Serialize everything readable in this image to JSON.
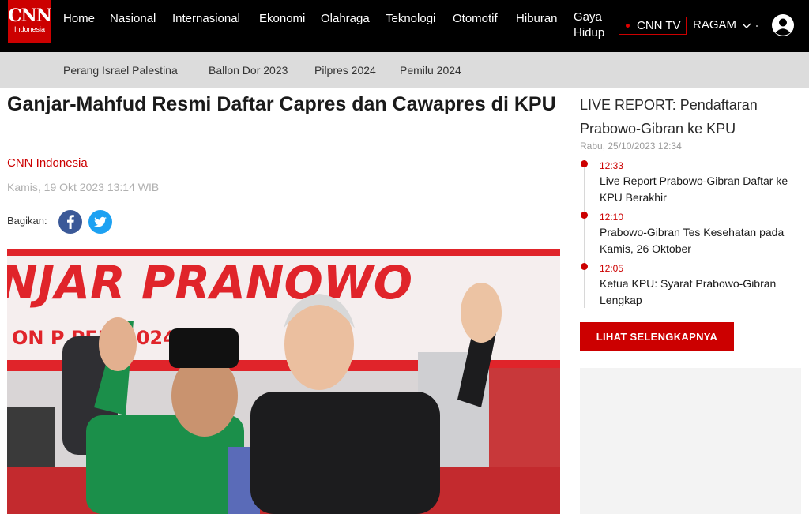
{
  "logo": {
    "title": "CNN",
    "subtitle": "Indonesia"
  },
  "nav": {
    "items": [
      "Home",
      "Nasional",
      "Internasional",
      "Ekonomi",
      "Olahraga",
      "Teknologi",
      "Otomotif",
      "Hiburan",
      "Gaya Hidup"
    ],
    "tv_label": "CNN TV",
    "ragam_label": "RAGAM"
  },
  "subnav": {
    "items": [
      "Perang Israel Palestina",
      "Ballon Dor 2023",
      "Pilpres 2024",
      "Pemilu 2024"
    ]
  },
  "article": {
    "headline": "Ganjar-Mahfud Resmi Daftar Capres dan Cawapres di KPU",
    "author": "CNN Indonesia",
    "date": "Kamis, 19 Okt 2023 13:14 WIB",
    "share_label": "Bagikan:",
    "photo_banner_text": "NJAR PRANOWO",
    "photo_sub_text": "ON P        PEM      2024)"
  },
  "sidebar": {
    "live_title": "LIVE REPORT: Pendaftaran Prabowo-Gibran ke KPU",
    "live_date": "Rabu, 25/10/2023 12:34",
    "updates": [
      {
        "time": "12:33",
        "text": "Live Report Prabowo-Gibran Daftar ke KPU Berakhir"
      },
      {
        "time": "12:10",
        "text": "Prabowo-Gibran Tes Kesehatan pada Kamis, 26 Oktober"
      },
      {
        "time": "12:05",
        "text": "Ketua KPU: Syarat Prabowo-Gibran Lengkap"
      }
    ],
    "more_label": "LIHAT SELENGKAPNYA"
  },
  "colors": {
    "brand": "#cc0000",
    "nav_bg": "#000000",
    "subnav_bg": "#dcdcdc",
    "facebook": "#3b5998",
    "twitter": "#1da1f2"
  },
  "icons": [
    "cnn-logo-icon",
    "chevron-down-icon",
    "user-avatar-icon",
    "facebook-icon",
    "twitter-icon"
  ]
}
